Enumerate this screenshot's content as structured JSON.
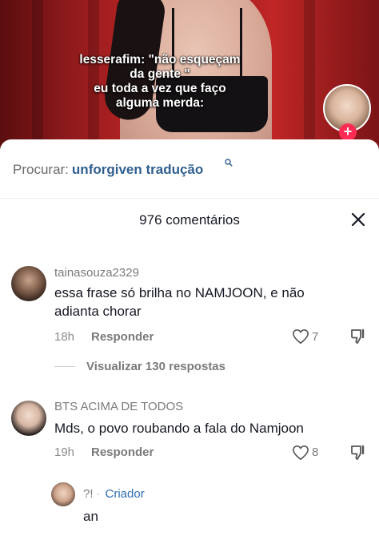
{
  "video": {
    "caption": "lesserafim: \"não esqueçam\nda gente \"\neu toda a vez que faço\nalguma merda:"
  },
  "search": {
    "prefix": "Procurar:",
    "query": "unforgiven tradução"
  },
  "comments_header": {
    "count_label": "976 comentários"
  },
  "comments": [
    {
      "username": "tainasouza2329",
      "text": "essa frase só brilha no NAMJOON, e não adianta chorar",
      "time": "18h",
      "reply_label": "Responder",
      "likes": "7",
      "view_replies": "Visualizar 130 respostas"
    },
    {
      "username": "BTS ACIMA DE TODOS",
      "text": "Mds, o povo roubando a fala do Namjoon",
      "time": "19h",
      "reply_label": "Responder",
      "likes": "8"
    }
  ],
  "reply": {
    "username": "?!",
    "badge": "Criador",
    "text": "an"
  },
  "colors": {
    "accent": "#fe2c55",
    "link": "#2f5f8f"
  }
}
